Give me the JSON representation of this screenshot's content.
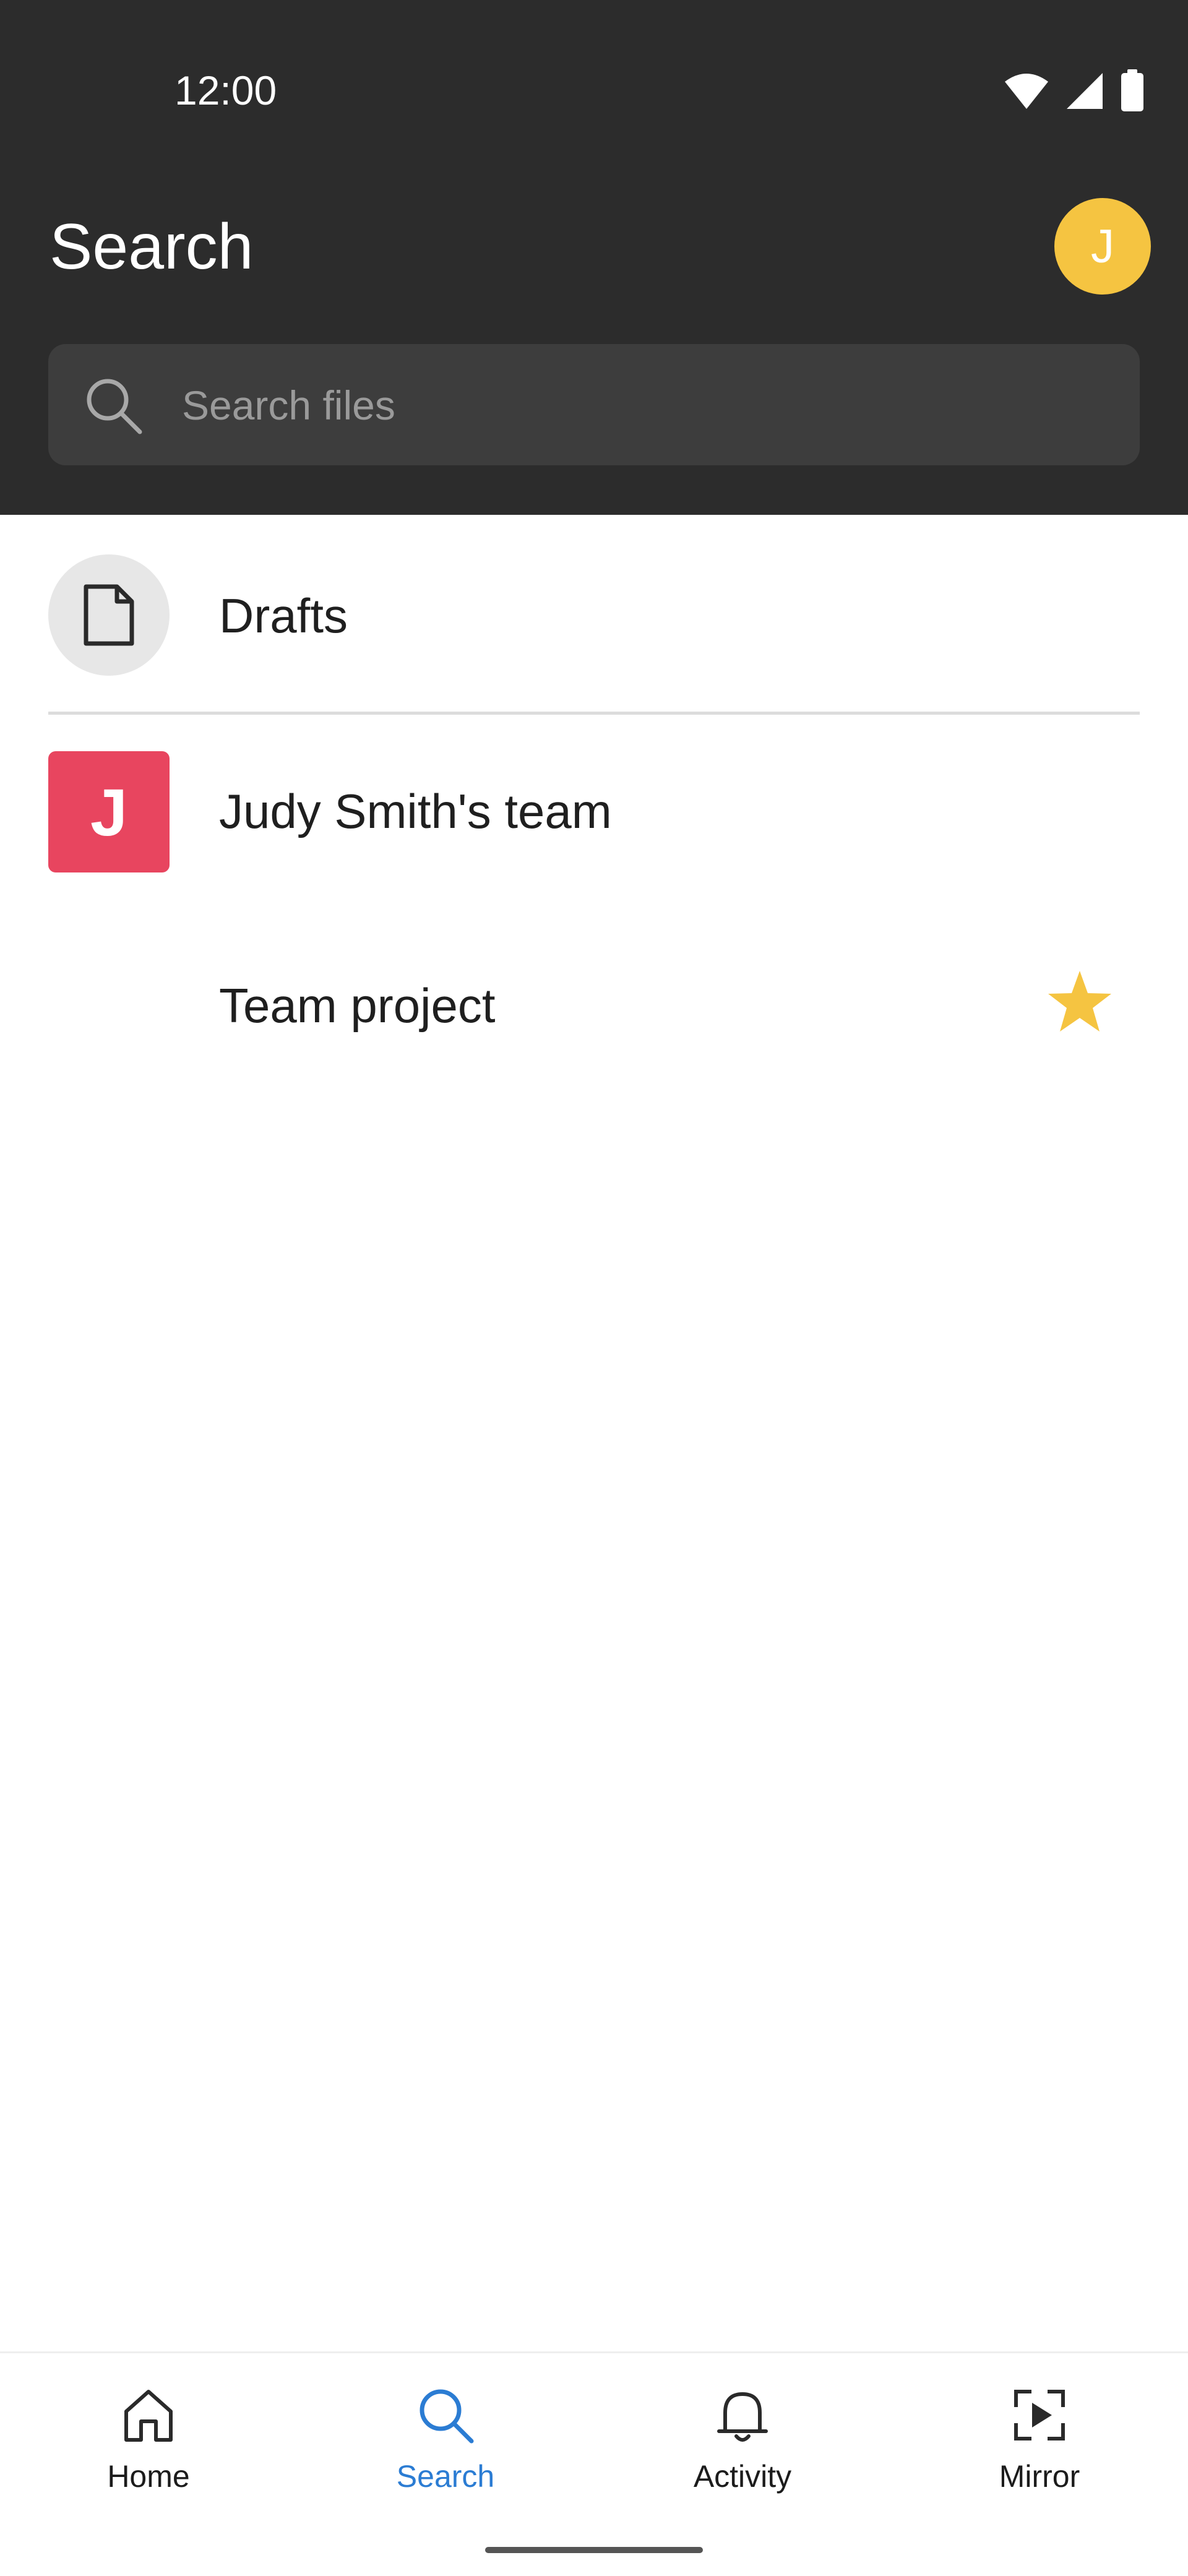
{
  "status_bar": {
    "time": "12:00"
  },
  "header": {
    "title": "Search",
    "avatar_initial": "J"
  },
  "search": {
    "placeholder": "Search files",
    "value": ""
  },
  "list": {
    "drafts_label": "Drafts",
    "team_initial": "J",
    "team_label": "Judy Smith's team",
    "project_label": "Team project"
  },
  "bottom_nav": {
    "items": [
      {
        "label": "Home",
        "icon": "home-icon"
      },
      {
        "label": "Search",
        "icon": "search-icon"
      },
      {
        "label": "Activity",
        "icon": "bell-icon"
      },
      {
        "label": "Mirror",
        "icon": "mirror-icon"
      }
    ],
    "active_index": 1
  },
  "colors": {
    "header_bg": "#2c2c2c",
    "avatar": "#f5c441",
    "team_square": "#e8455f",
    "star": "#f5c441",
    "active_nav": "#2b7cd3"
  }
}
